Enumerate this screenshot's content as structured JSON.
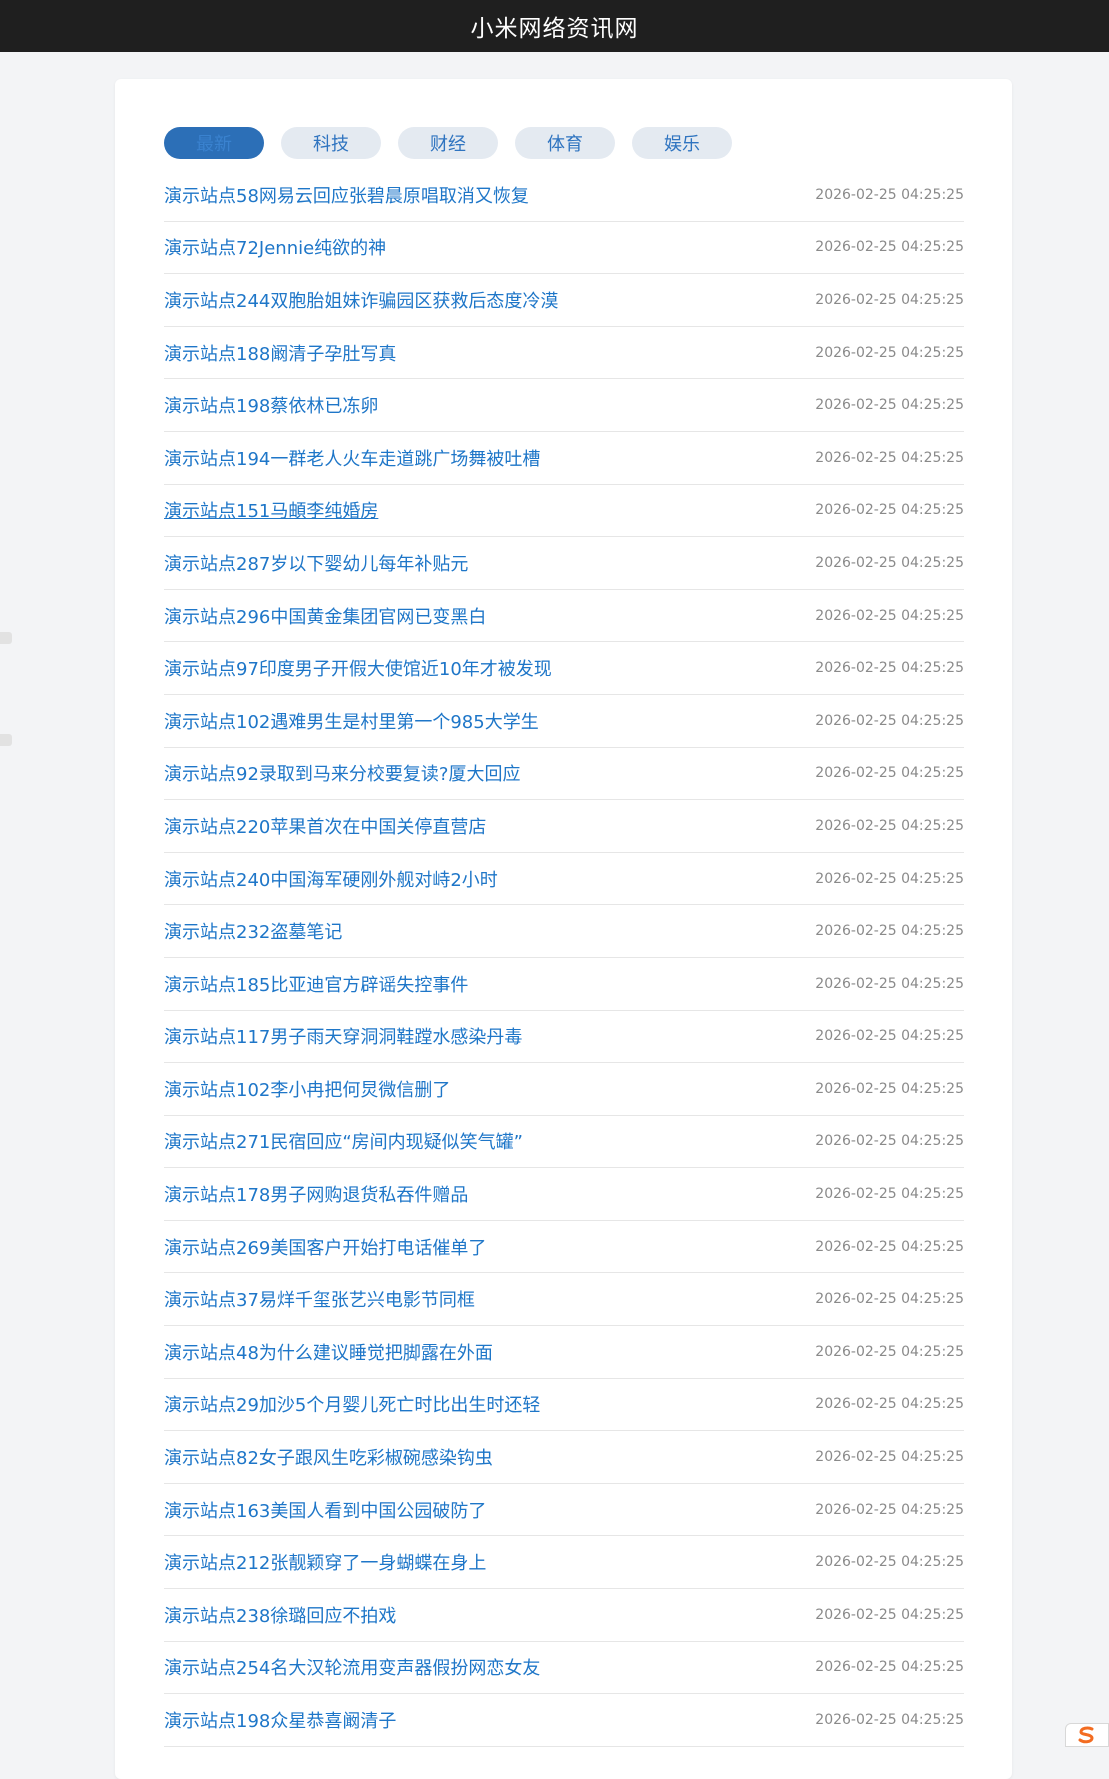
{
  "header": {
    "title": "小米网络资讯网"
  },
  "tabs": [
    {
      "label": "最新",
      "active": true
    },
    {
      "label": "科技",
      "active": false
    },
    {
      "label": "财经",
      "active": false
    },
    {
      "label": "体育",
      "active": false
    },
    {
      "label": "娱乐",
      "active": false
    }
  ],
  "articles": [
    {
      "title": "演示站点58网易云回应张碧晨原唱取消又恢复",
      "time": "2026-02-25 04:25:25"
    },
    {
      "title": "演示站点72Jennie纯欲的神",
      "time": "2026-02-25 04:25:25"
    },
    {
      "title": "演示站点244双胞胎姐妹诈骗园区获救后态度冷漠",
      "time": "2026-02-25 04:25:25"
    },
    {
      "title": "演示站点188阚清子孕肚写真",
      "time": "2026-02-25 04:25:25"
    },
    {
      "title": "演示站点198蔡依林已冻卵",
      "time": "2026-02-25 04:25:25"
    },
    {
      "title": "演示站点194一群老人火车走道跳广场舞被吐槽",
      "time": "2026-02-25 04:25:25"
    },
    {
      "title": "演示站点151马頔李纯婚房",
      "time": "2026-02-25 04:25:25",
      "hovered": true
    },
    {
      "title": "演示站点287岁以下婴幼儿每年补贴元",
      "time": "2026-02-25 04:25:25"
    },
    {
      "title": "演示站点296中国黄金集团官网已变黑白",
      "time": "2026-02-25 04:25:25"
    },
    {
      "title": "演示站点97印度男子开假大使馆近10年才被发现",
      "time": "2026-02-25 04:25:25"
    },
    {
      "title": "演示站点102遇难男生是村里第一个985大学生",
      "time": "2026-02-25 04:25:25"
    },
    {
      "title": "演示站点92录取到马来分校要复读?厦大回应",
      "time": "2026-02-25 04:25:25"
    },
    {
      "title": "演示站点220苹果首次在中国关停直营店",
      "time": "2026-02-25 04:25:25"
    },
    {
      "title": "演示站点240中国海军硬刚外舰对峙2小时",
      "time": "2026-02-25 04:25:25"
    },
    {
      "title": "演示站点232盗墓笔记",
      "time": "2026-02-25 04:25:25"
    },
    {
      "title": "演示站点185比亚迪官方辟谣失控事件",
      "time": "2026-02-25 04:25:25"
    },
    {
      "title": "演示站点117男子雨天穿洞洞鞋蹚水感染丹毒",
      "time": "2026-02-25 04:25:25"
    },
    {
      "title": "演示站点102李小冉把何炅微信删了",
      "time": "2026-02-25 04:25:25"
    },
    {
      "title": "演示站点271民宿回应“房间内现疑似笑气罐”",
      "time": "2026-02-25 04:25:25"
    },
    {
      "title": "演示站点178男子网购退货私吞件赠品",
      "time": "2026-02-25 04:25:25"
    },
    {
      "title": "演示站点269美国客户开始打电话催单了",
      "time": "2026-02-25 04:25:25"
    },
    {
      "title": "演示站点37易烊千玺张艺兴电影节同框",
      "time": "2026-02-25 04:25:25"
    },
    {
      "title": "演示站点48为什么建议睡觉把脚露在外面",
      "time": "2026-02-25 04:25:25"
    },
    {
      "title": "演示站点29加沙5个月婴儿死亡时比出生时还轻",
      "time": "2026-02-25 04:25:25"
    },
    {
      "title": "演示站点82女子跟风生吃彩椒碗感染钩虫",
      "time": "2026-02-25 04:25:25"
    },
    {
      "title": "演示站点163美国人看到中国公园破防了",
      "time": "2026-02-25 04:25:25"
    },
    {
      "title": "演示站点212张靓颖穿了一身蝴蝶在身上",
      "time": "2026-02-25 04:25:25"
    },
    {
      "title": "演示站点238徐璐回应不拍戏",
      "time": "2026-02-25 04:25:25"
    },
    {
      "title": "演示站点254名大汉轮流用变声器假扮网恋女友",
      "time": "2026-02-25 04:25:25"
    },
    {
      "title": "演示站点198众星恭喜阚清子",
      "time": "2026-02-25 04:25:25"
    }
  ],
  "colors": {
    "header_bg": "#1f1f1f",
    "link": "#1e76c8",
    "tab_active_bg": "#2c6fb7",
    "tab_bg": "#e4eaf1",
    "widget_accent": "#f36c21"
  },
  "icons": {
    "corner_widget": "sogou-input-icon"
  }
}
